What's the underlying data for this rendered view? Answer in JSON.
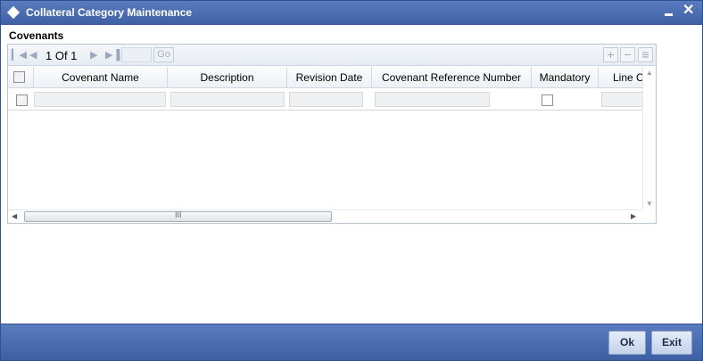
{
  "window": {
    "title": "Collateral Category Maintenance",
    "close_glyph": "✕"
  },
  "covenants": {
    "section_label": "Covenants",
    "pager": {
      "page_info": "1 Of 1",
      "go_label": "Go",
      "icons": [
        "first-page-icon",
        "prev-page-icon",
        "next-page-icon",
        "last-page-icon",
        "add-row-icon",
        "remove-row-icon",
        "single-view-icon"
      ]
    },
    "columns": [
      "Covenant Name",
      "Description",
      "Revision Date",
      "Covenant Reference Number",
      "Mandatory",
      "Line Code"
    ],
    "visible_column_text": [
      "Covenant Name",
      "Description",
      "Revision Date",
      "Covenant Reference Number",
      "Mandatory",
      "Line C"
    ],
    "rows": [
      {
        "covenant_name": "",
        "description": "",
        "revision_date": "",
        "covenant_reference_number": "",
        "mandatory": false,
        "line_code": ""
      }
    ],
    "scroll_grip": "III"
  },
  "footer": {
    "ok_label": "Ok",
    "exit_label": "Exit"
  },
  "colors": {
    "titlebar": "#4a6cb0",
    "footer": "#4a6cb0",
    "button_bg": "#d4e0f1"
  }
}
